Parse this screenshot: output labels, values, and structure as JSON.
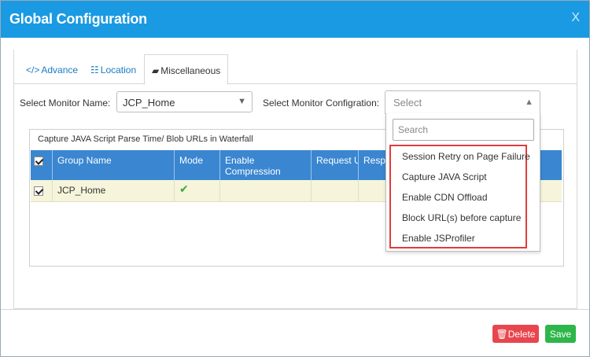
{
  "dialog": {
    "title": "Global Configuration",
    "close_label": "X"
  },
  "tabs": [
    {
      "icon": "</>",
      "label": "Advance"
    },
    {
      "icon": "☷",
      "label": "Location"
    },
    {
      "icon": "▰",
      "label": "Miscellaneous"
    }
  ],
  "form": {
    "monitor_name_label": "Select Monitor Name:",
    "monitor_name_value": "JCP_Home",
    "monitor_config_label": "Select Monitor Configration:",
    "monitor_config_placeholder": "Select",
    "search_placeholder": "Search"
  },
  "dropdown_options": [
    "Session Retry on Page Failure",
    "Capture JAVA Script",
    "Enable CDN Offload",
    "Block URL(s) before capture",
    "Enable JSProfiler"
  ],
  "panel": {
    "heading": "Capture JAVA Script Parse Time/ Blob URLs in Waterfall",
    "columns": [
      "Group Name",
      "Mode",
      "Enable Compression",
      "Request U",
      "Respo"
    ],
    "rows": [
      {
        "group_name": "JCP_Home",
        "mode_icon": "check-icon"
      }
    ]
  },
  "footer": {
    "delete_label": "Delete",
    "save_label": "Save"
  },
  "colors": {
    "title_bar": "#1a9ae3",
    "header": "#3a86d1",
    "delete": "#e8464e",
    "save": "#2eb64a",
    "highlight": "#e03c3c"
  }
}
